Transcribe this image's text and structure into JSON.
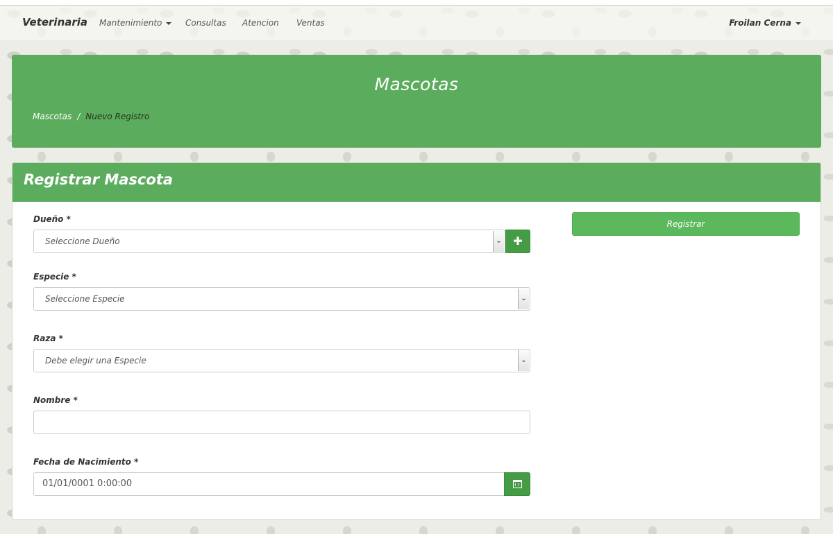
{
  "navbar": {
    "brand": "Veterinaria",
    "items": [
      {
        "label": "Mantenimiento",
        "has_dropdown": true
      },
      {
        "label": "Consultas"
      },
      {
        "label": "Atencion"
      },
      {
        "label": "Ventas"
      }
    ],
    "user": "Froilan Cerna"
  },
  "hero": {
    "title": "Mascotas",
    "breadcrumb": [
      "Mascotas",
      "Nuevo Registro"
    ]
  },
  "form": {
    "title": "Registrar Mascota",
    "submit_label": "Registrar",
    "fields": {
      "owner": {
        "label": "Dueño *",
        "value": "Seleccione Dueño",
        "add_icon": "plus-icon"
      },
      "species": {
        "label": "Especie *",
        "value": "Seleccione Especie"
      },
      "breed": {
        "label": "Raza *",
        "value": "Debe elegir una Especie"
      },
      "name": {
        "label": "Nombre *",
        "value": ""
      },
      "birthdate": {
        "label": "Fecha de Nacimiento *",
        "value": "01/01/0001 0:00:00",
        "icon": "calendar-icon"
      }
    }
  },
  "colors": {
    "primary_green": "#5cac5e",
    "button_green": "#5cb85c",
    "dark_green": "#449d44"
  }
}
